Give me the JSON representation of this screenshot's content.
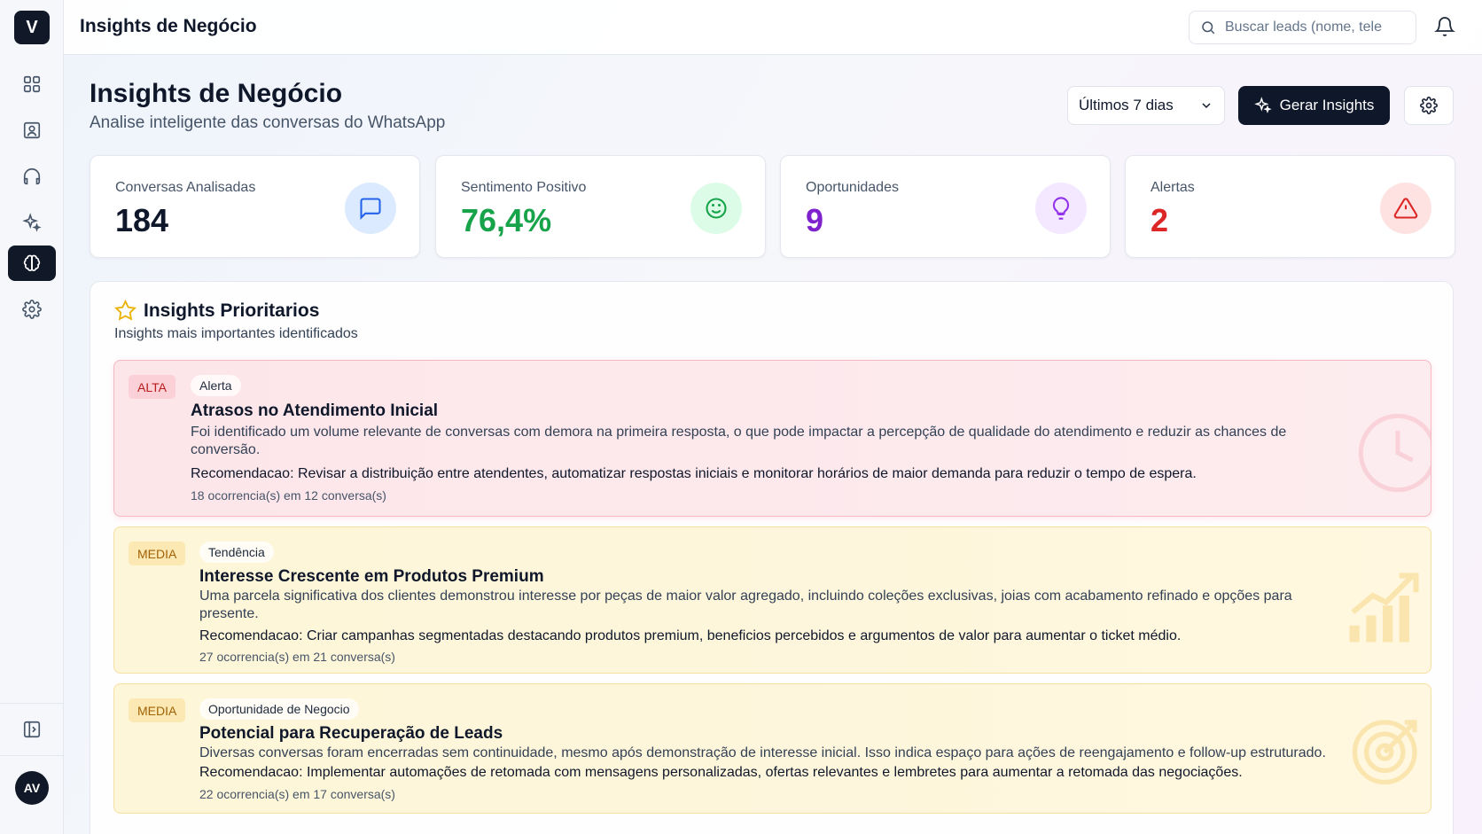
{
  "sidebar": {
    "logo": "V",
    "items": [
      {
        "name": "dashboard",
        "icon": "grid-icon"
      },
      {
        "name": "leads",
        "icon": "contact-icon"
      },
      {
        "name": "support",
        "icon": "headphones-icon"
      },
      {
        "name": "ai",
        "icon": "sparkles-icon"
      },
      {
        "name": "insights",
        "icon": "brain-icon",
        "active": true
      },
      {
        "name": "settings",
        "icon": "gear-icon"
      }
    ],
    "collapse_icon": "sidebar-toggle-icon",
    "avatar_initials": "AV"
  },
  "topbar": {
    "title": "Insights de Negócio",
    "search_placeholder": "Buscar leads (nome, tele",
    "notification_icon": "bell-icon"
  },
  "page": {
    "title": "Insights de Negócio",
    "subtitle": "Analise inteligente das conversas do WhatsApp",
    "period": "Últimos 7 dias",
    "generate_label": "Gerar Insights"
  },
  "stats": [
    {
      "label": "Conversas Analisadas",
      "value": "184",
      "color": "#0f172a",
      "icon": "chat-icon",
      "icon_color": "#2563eb",
      "icon_bg": "#dbeafe"
    },
    {
      "label": "Sentimento Positivo",
      "value": "76,4%",
      "color": "#16a34a",
      "icon": "smile-icon",
      "icon_color": "#16a34a",
      "icon_bg": "#dcfce7"
    },
    {
      "label": "Oportunidades",
      "value": "9",
      "color": "#7e22ce",
      "icon": "lightbulb-icon",
      "icon_color": "#9333ea",
      "icon_bg": "#f3e8ff"
    },
    {
      "label": "Alertas",
      "value": "2",
      "color": "#dc2626",
      "icon": "warning-icon",
      "icon_color": "#dc2626",
      "icon_bg": "#fee2e2"
    }
  ],
  "priority": {
    "title": "Insights Prioritarios",
    "subtitle": "Insights mais importantes identificados",
    "items": [
      {
        "priority": "ALTA",
        "type": "Alerta",
        "title": "Atrasos no Atendimento Inicial",
        "description": "Foi identificado um volume relevante de conversas com demora na primeira resposta, o que pode impactar a percepção de qualidade do atendimento e reduzir as chances de conversão.",
        "recommendation": "Recomendacao: Revisar a distribuição entre atendentes, automatizar respostas iniciais e monitorar horários de maior demanda para reduzir o tempo de espera.",
        "meta": "18 ocorrencia(s) em 12 conversa(s)",
        "deco_icon": "clock-icon"
      },
      {
        "priority": "MEDIA",
        "type": "Tendência",
        "title": "Interesse Crescente em Produtos Premium",
        "description": "Uma parcela significativa dos clientes demonstrou interesse por peças de maior valor agregado, incluindo coleções exclusivas, joias com acabamento refinado e opções para presente.",
        "recommendation": "Recomendacao: Criar campanhas segmentadas destacando produtos premium, beneficios percebidos e argumentos de valor para aumentar o ticket médio.",
        "meta": "27 ocorrencia(s) em 21 conversa(s)",
        "deco_icon": "trend-chart-icon"
      },
      {
        "priority": "MEDIA",
        "type": "Oportunidade de Negocio",
        "title": "Potencial para Recuperação de Leads",
        "description": "Diversas conversas foram encerradas sem continuidade, mesmo após demonstração de interesse inicial. Isso indica espaço para ações de reengajamento e follow-up estruturado.",
        "recommendation": "Recomendacao: Implementar automações de retomada com mensagens personalizadas, ofertas relevantes e lembretes para aumentar a retomada das negociações.",
        "meta": "22 ocorrencia(s) em 17 conversa(s)",
        "deco_icon": "target-icon"
      }
    ]
  }
}
